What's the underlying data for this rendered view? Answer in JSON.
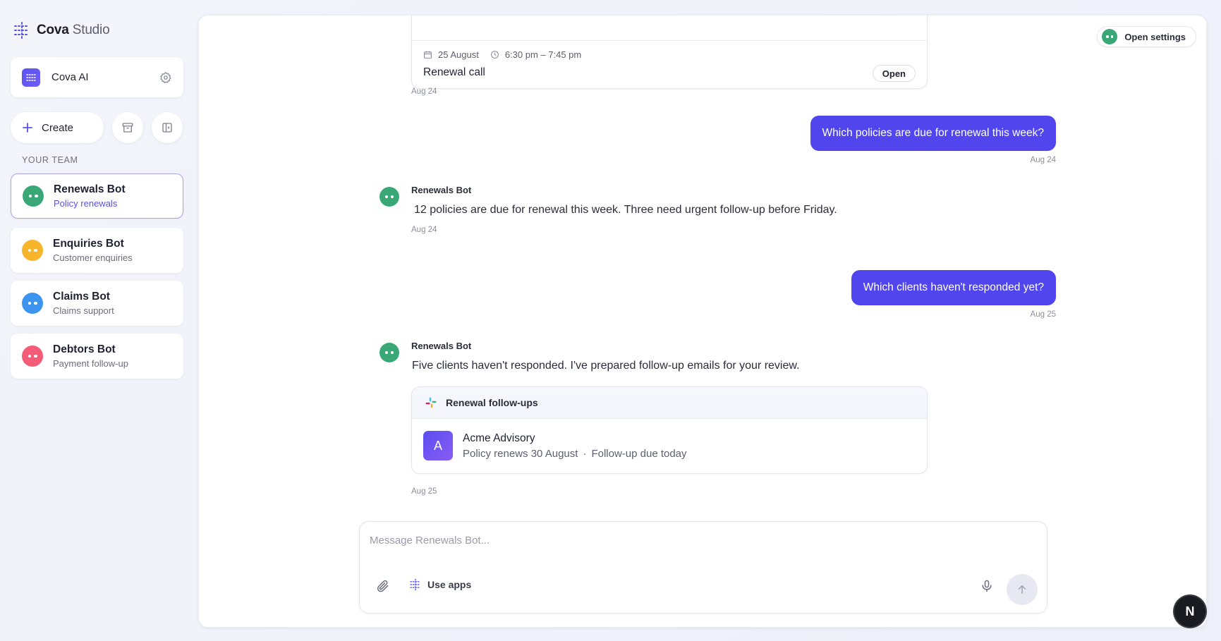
{
  "brand": {
    "name_bold": "Cova",
    "name_light": "Studio"
  },
  "workspace": {
    "name": "Cova AI"
  },
  "sidebar": {
    "create_label": "Create",
    "team_label": "YOUR TEAM",
    "bots": [
      {
        "name": "Renewals Bot",
        "sub": "Policy renewals",
        "color": "#3aa777",
        "active": true
      },
      {
        "name": "Enquiries Bot",
        "sub": "Customer enquiries",
        "color": "#f7b52c",
        "active": false
      },
      {
        "name": "Claims Bot",
        "sub": "Claims support",
        "color": "#3b95f0",
        "active": false
      },
      {
        "name": "Debtors Bot",
        "sub": "Payment follow-up",
        "color": "#f45b77",
        "active": false
      }
    ]
  },
  "header": {
    "open_settings_label": "Open settings"
  },
  "event": {
    "date": "25 August",
    "time": "6:30 pm – 7:45 pm",
    "title": "Renewal call",
    "open_label": "Open"
  },
  "messages": {
    "ts1": "Aug 24",
    "user1": "Which policies are due for renewal this week?",
    "ts2": "Aug 24",
    "bot1_name": "Renewals Bot",
    "bot1_text": "12 policies are due for renewal this week. Three need urgent follow-up before Friday.",
    "ts3": "Aug 24",
    "user2": "Which clients haven't responded yet?",
    "ts4": "Aug 25",
    "bot2_name": "Renewals Bot",
    "bot2_text": "Five clients haven't responded. I've prepared follow-up emails for your review.",
    "ts5": "Aug 25"
  },
  "followups": {
    "title": "Renewal follow-ups",
    "client_initial": "A",
    "client_name": "Acme Advisory",
    "client_policy": "Policy renews 30 August",
    "client_due": "Follow-up due today"
  },
  "composer": {
    "placeholder": "Message Renewals Bot...",
    "use_apps_label": "Use apps"
  },
  "corner_badge": "N"
}
